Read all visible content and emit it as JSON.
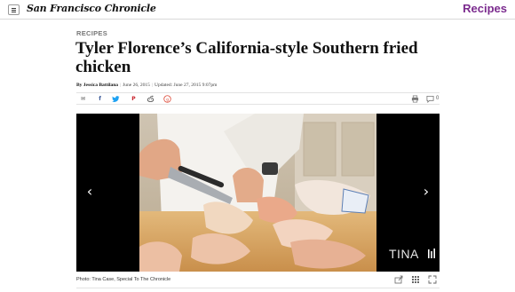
{
  "header": {
    "masthead": "San Francisco Chronicle",
    "section": "Recipes"
  },
  "article": {
    "kicker": "RECIPES",
    "headline": "Tyler Florence’s California-style Southern fried chicken",
    "byline": "By Jessica Battilana",
    "published": "June 26, 2015",
    "updated": "Updated: June 27, 2015 9:07pm",
    "comment_count": "0"
  },
  "share": {
    "icons": [
      "mail-icon",
      "facebook-icon",
      "twitter-icon",
      "pinterest-icon",
      "reddit-icon",
      "google-plus-icon",
      "print-icon",
      "comment-icon"
    ]
  },
  "gallery": {
    "watermark": "TINA",
    "caption": "Photo: Tina Case, Special To The Chronicle",
    "prev_glyph": "‹",
    "next_glyph": "›"
  },
  "colors": {
    "section_accent": "#7b2b8e",
    "gallery_bg": "#000000",
    "facebook": "#3b5998",
    "twitter": "#1da1f2",
    "pinterest": "#c8232c",
    "google_plus": "#dd4b39"
  }
}
